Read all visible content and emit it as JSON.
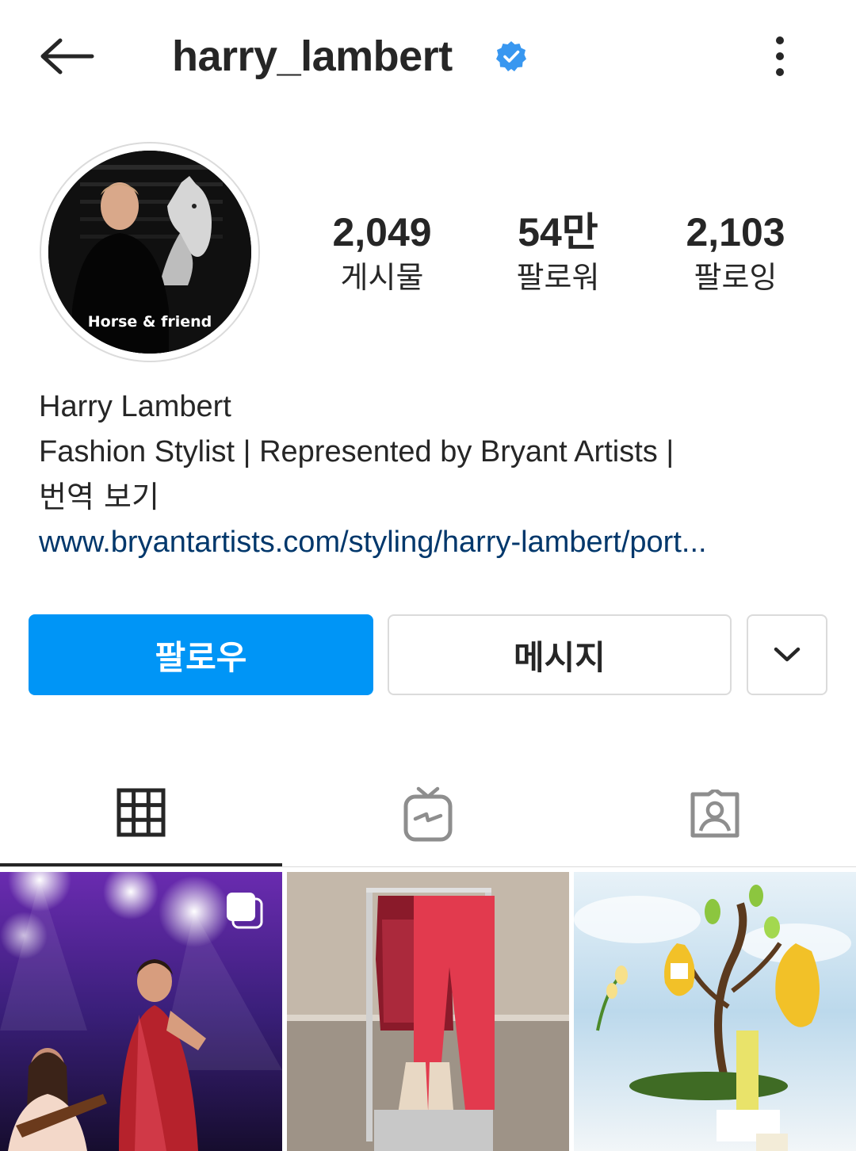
{
  "header": {
    "username": "harry_lambert",
    "verified": true,
    "icons": {
      "back": "arrow-left-icon",
      "verified": "verified-badge-icon",
      "more": "more-vertical-icon"
    }
  },
  "profile": {
    "avatar_caption": "Horse & friend",
    "stats": [
      {
        "value": "2,049",
        "label": "게시물"
      },
      {
        "value": "54만",
        "label": "팔로워"
      },
      {
        "value": "2,103",
        "label": "팔로잉"
      }
    ],
    "bio": {
      "name": "Harry Lambert",
      "description": "Fashion Stylist | Represented by Bryant Artists |",
      "translate": "번역 보기",
      "link": "www.bryantartists.com/styling/harry-lambert/port..."
    }
  },
  "actions": {
    "follow_label": "팔로우",
    "message_label": "메시지",
    "more_icon": "chevron-down-icon"
  },
  "tabs": [
    {
      "icon": "grid-icon",
      "active": true
    },
    {
      "icon": "igtv-icon",
      "active": false
    },
    {
      "icon": "tagged-icon",
      "active": false
    }
  ],
  "colors": {
    "primary_blue": "#0095f6",
    "link_blue": "#00376b",
    "verified_blue": "#3897f0",
    "text": "#262626",
    "border": "#dbdbdb"
  }
}
